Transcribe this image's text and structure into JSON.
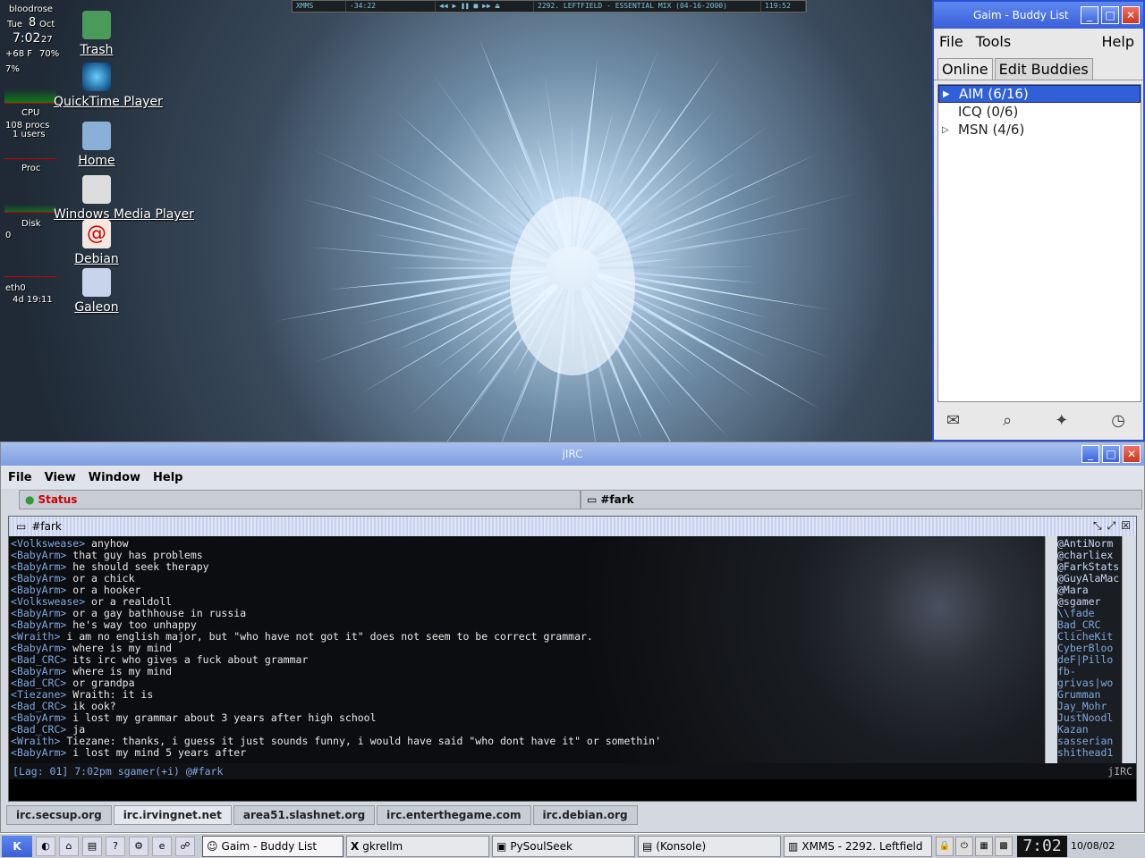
{
  "gkrellm": {
    "host": "bloodrose",
    "day": "Tue",
    "date": "8",
    "month": "Oct",
    "time": "7:02",
    "seconds": "27",
    "temp": "+68 F",
    "battery": "70%",
    "cpu_pct": "7%",
    "cpu_label": "CPU",
    "procs": "108 procs",
    "users": "1 users",
    "proc_label": "Proc",
    "disk_label": "Disk",
    "disk_val": "0",
    "net_label": "eth0",
    "uptime": "4d 19:11"
  },
  "desktop_icons": [
    {
      "label": "Trash",
      "icon": "trash-icon"
    },
    {
      "label": "QuickTime Player",
      "icon": "quicktime-icon"
    },
    {
      "label": "Home",
      "icon": "home-icon"
    },
    {
      "label": "Windows Media Player",
      "icon": "media-player-icon"
    },
    {
      "label": "Debian",
      "icon": "debian-icon"
    },
    {
      "label": "Galeon",
      "icon": "galeon-icon"
    }
  ],
  "xmms": {
    "title": "XMMS",
    "time": "-34:22",
    "track": "2292. LEFTFIELD - ESSENTIAL MIX (04-16-2000)",
    "length": "119:52"
  },
  "gaim": {
    "title": "Gaim - Buddy List",
    "menu": [
      "File",
      "Tools",
      "Help"
    ],
    "tabs": [
      "Online",
      "Edit Buddies"
    ],
    "groups": [
      "AIM (6/16)",
      "ICQ (0/6)",
      "MSN (4/6)"
    ]
  },
  "jirc": {
    "title": "jIRC",
    "menu": [
      "File",
      "View",
      "Window",
      "Help"
    ],
    "status_tab": "Status",
    "channel_tab": "#fark",
    "channel": "#fark",
    "log": [
      {
        "nick": "Volkswease",
        "text": "anyhow"
      },
      {
        "nick": "BabyArm",
        "text": "that guy has problems"
      },
      {
        "nick": "BabyArm",
        "text": "he should seek therapy"
      },
      {
        "nick": "BabyArm",
        "text": "or a chick"
      },
      {
        "nick": "BabyArm",
        "text": "or a hooker"
      },
      {
        "nick": "Volkswease",
        "text": "or a realdoll"
      },
      {
        "nick": "BabyArm",
        "text": "or a gay bathhouse in russia"
      },
      {
        "nick": "BabyArm",
        "text": "he's way too unhappy"
      },
      {
        "nick": "Wraith",
        "text": "i am no english major, but \"who have not got it\" does not seem to be correct grammar."
      },
      {
        "nick": "BabyArm",
        "text": "where is my mind"
      },
      {
        "nick": "Bad_CRC",
        "text": "its irc who gives a fuck about grammar"
      },
      {
        "nick": "BabyArm",
        "text": "where is my mind"
      },
      {
        "nick": "Bad_CRC",
        "text": "or grandpa"
      },
      {
        "nick": "Tiezane",
        "text": "Wraith: it is"
      },
      {
        "nick": "Bad_CRC",
        "text": "ik ook?"
      },
      {
        "nick": "BabyArm",
        "text": "i lost my grammar about 3 years after high school"
      },
      {
        "nick": "Bad_CRC",
        "text": "ja"
      },
      {
        "nick": "Wraith",
        "text": "Tiezane: thanks, i guess it just sounds funny, i would have said \"who dont have it\" or somethin'"
      },
      {
        "nick": "BabyArm",
        "text": "i lost my mind 5 years after"
      }
    ],
    "users": [
      "@AntiNorm",
      "@charliex",
      "@FarkStats",
      "@GuyAlaMac",
      "@Mara",
      "@sgamer",
      "\\\\fade",
      "Bad_CRC",
      "ClicheKit",
      "CyberBloo",
      "deF|Pillo",
      "fb-",
      "grivas|wo",
      "Grumman",
      "Jay_Mohr",
      "JustNoodl",
      "Kazan",
      "sasserian",
      "shithead1"
    ],
    "statusline": "[Lag: 01] 7:02pm sgamer(+i) @#fark",
    "statusline_right": "jIRC",
    "servers": [
      "irc.secsup.org",
      "irc.irvingnet.net",
      "area51.slashnet.org",
      "irc.enterthegame.com",
      "irc.debian.org"
    ]
  },
  "taskbar": {
    "start": "K",
    "tasks": [
      "Gaim - Buddy List",
      "gkrellm",
      "PySoulSeek",
      "(Konsole)",
      "XMMS - 2292. Leftfield"
    ],
    "clock": "7:02",
    "date": "10/08/02"
  }
}
